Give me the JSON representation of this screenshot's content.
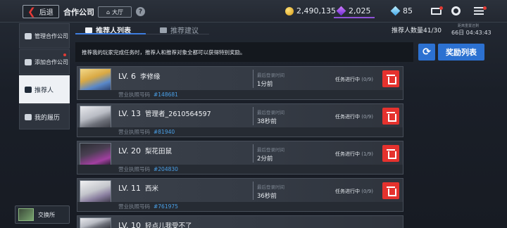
{
  "topbar": {
    "back_label": "后退",
    "title": "合作公司",
    "hall_label": "大厅",
    "help_glyph": "?",
    "gold": "2,490,135",
    "crystal": "2,025",
    "diamond": "85"
  },
  "sidebar": {
    "items": [
      {
        "label": "管理合作公司",
        "icon": "company-icon"
      },
      {
        "label": "添加合作公司",
        "icon": "add-company-icon",
        "has_dot": true
      },
      {
        "label": "推荐人",
        "icon": "referrer-icon",
        "active": true
      },
      {
        "label": "我的履历",
        "icon": "resume-icon"
      }
    ],
    "exchange_label": "交换所"
  },
  "tabs": [
    {
      "label": "推荐人列表",
      "active": true
    },
    {
      "label": "推荐建议",
      "active": false
    }
  ],
  "header": {
    "count_label": "推荐人数量41/30",
    "time_small": "距离重置还剩",
    "time_main": "66日 04:43:43"
  },
  "info": {
    "text": "推荐我的玩家完成任务时，推荐人和推荐对象全都可以获得特别奖励。",
    "refresh_glyph": "⟳",
    "reward_list_label": "奖励列表"
  },
  "rows": [
    {
      "level": "LV. 6",
      "name": "李修缘",
      "login_label": "最后登录时间",
      "login": "1分前",
      "task": "任务进行中",
      "progress": "(0/9)",
      "license_label": "营业执照号码",
      "license": "#148681",
      "avatar": "blonde"
    },
    {
      "level": "LV. 13",
      "name": "管理者_2610564597",
      "login_label": "最后登录时间",
      "login": "38秒前",
      "task": "任务进行中",
      "progress": "(0/9)",
      "license_label": "营业执照号码",
      "license": "#81940",
      "avatar": "silver"
    },
    {
      "level": "LV. 20",
      "name": "梨花田鼠",
      "login_label": "最后登录时间",
      "login": "2分前",
      "task": "任务进行中",
      "progress": "(1/9)",
      "license_label": "营业执照号码",
      "license": "#204830",
      "avatar": "dark"
    },
    {
      "level": "LV. 11",
      "name": "西米",
      "login_label": "最后登录时间",
      "login": "36秒前",
      "task": "任务进行中",
      "progress": "(0/9)",
      "license_label": "营业执照号码",
      "license": "#761975",
      "avatar": "silver2"
    },
    {
      "level": "LV. 10",
      "name": "轻点儿我受不了",
      "login_label": "",
      "login": "",
      "task": "",
      "progress": "",
      "license_label": "",
      "license": "",
      "avatar": "silver"
    }
  ],
  "colors": {
    "accent_blue": "#2c71d1",
    "delete_red": "#e5322e",
    "license_blue": "#4aa0e8"
  }
}
